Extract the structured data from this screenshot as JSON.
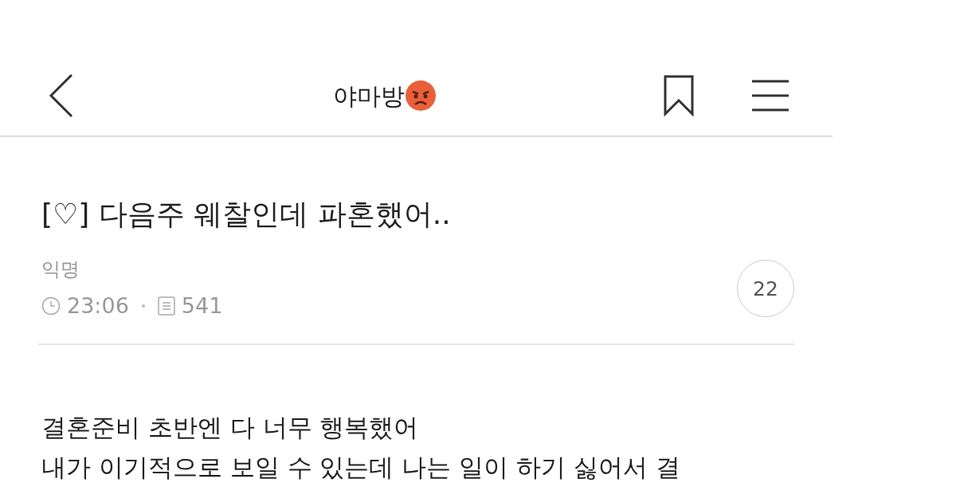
{
  "header": {
    "title": "야마방"
  },
  "post": {
    "title": "[♡] 다음주 웨찰인데 파혼했어..",
    "author": "익명",
    "time": "23:06",
    "views": "541",
    "comments": "22",
    "body": [
      "결혼준비 초반엔 다 너무 행복했어",
      "내가 이기적으로 보일 수 있는데 나는 일이 하기 싫어서 결"
    ]
  }
}
